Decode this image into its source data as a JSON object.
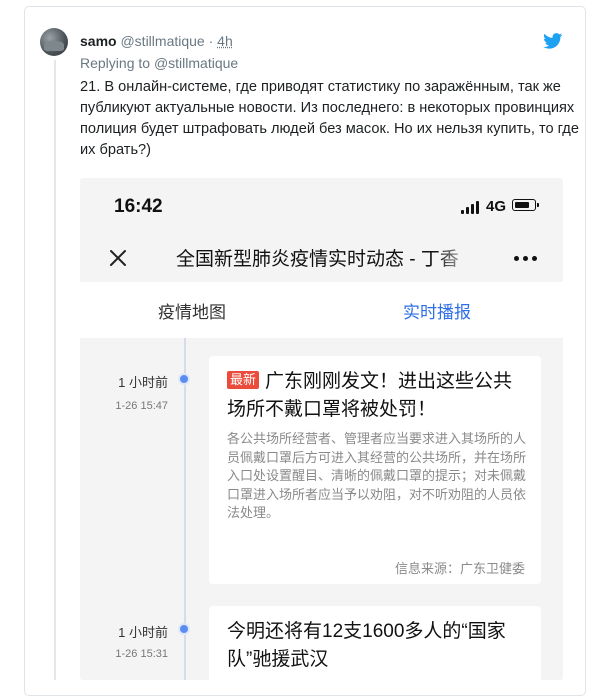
{
  "tweet": {
    "author_name": "samo",
    "author_handle": "@stillmatique",
    "separator": "·",
    "time": "4h",
    "reply_prefix": "Replying to ",
    "reply_to": "@stillmatique",
    "text": "21. В онлайн-системе, где приводят статистику по заражённым, так же публикуют актуальные новости. Из последнего: в некоторых провинциях полиция будет штрафовать людей без масок. Но их нельзя купить, то где их брать?)",
    "icons": {
      "avatar": "avatar",
      "brand": "twitter-bird-icon"
    },
    "colors": {
      "brand": "#1da1f2",
      "muted": "#697882"
    }
  },
  "screenshot": {
    "status_bar": {
      "clock": "16:42",
      "network": "4G",
      "icons": [
        "signal-icon",
        "battery-icon"
      ]
    },
    "nav": {
      "title": "全国新型肺炎疫情实时动态 - 丁香",
      "icons": [
        "close-icon",
        "more-icon"
      ]
    },
    "tabs": [
      {
        "label": "疫情地图",
        "active": false
      },
      {
        "label": "实时播报",
        "active": true
      }
    ],
    "colors": {
      "accent": "#2f6fe6",
      "badge": "#ea4b3a",
      "timeline_dot": "#5b8df0"
    },
    "feed": [
      {
        "time": "1 小时前",
        "date": "1-26 15:47",
        "badge": "最新",
        "title": "广东刚刚发文！进出这些公共场所不戴口罩将被处罚！",
        "body": "各公共场所经营者、管理者应当要求进入其场所的人员佩戴口罩后方可进入其经营的公共场所，并在场所入口处设置醒目、清晰的佩戴口罩的提示；对未佩戴口罩进入场所者应当予以劝阻，对不听劝阻的人员依法处理。",
        "source": "信息来源：广东卫健委"
      },
      {
        "time": "1 小时前",
        "date": "1-26 15:31",
        "badge": "",
        "title": "今明还将有12支1600多人的“国家队”驰援武汉",
        "body": "",
        "source": ""
      }
    ]
  }
}
